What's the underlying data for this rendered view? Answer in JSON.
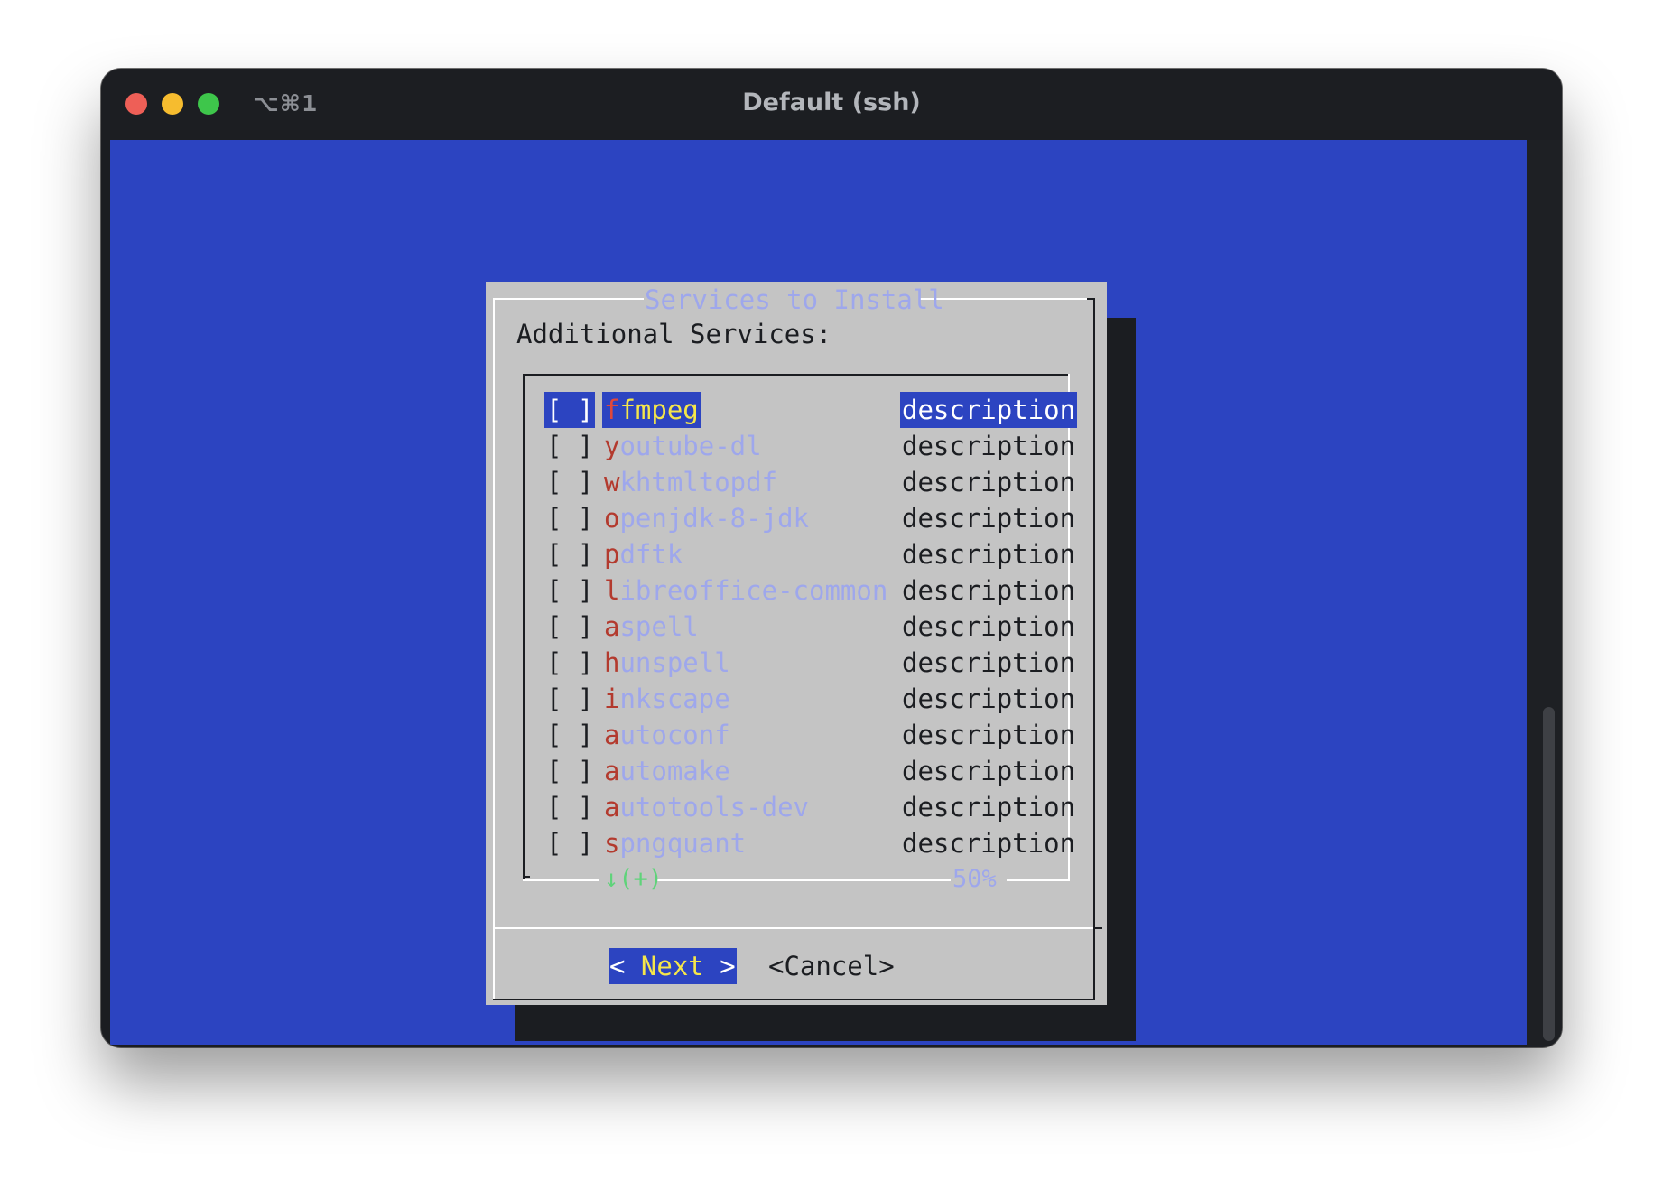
{
  "window": {
    "tab_shortcut": "⌥⌘1",
    "title": "Default (ssh)"
  },
  "dialog": {
    "title": "Services to Install",
    "subtitle": "Additional Services:",
    "items": [
      {
        "checkbox": "[ ]",
        "hotkey": "f",
        "rest": "fmpeg",
        "description": "description",
        "selected": true
      },
      {
        "checkbox": "[ ]",
        "hotkey": "y",
        "rest": "outube-dl",
        "description": "description",
        "selected": false
      },
      {
        "checkbox": "[ ]",
        "hotkey": "w",
        "rest": "khtmltopdf",
        "description": "description",
        "selected": false
      },
      {
        "checkbox": "[ ]",
        "hotkey": "o",
        "rest": "penjdk-8-jdk",
        "description": "description",
        "selected": false
      },
      {
        "checkbox": "[ ]",
        "hotkey": "p",
        "rest": "dftk",
        "description": "description",
        "selected": false
      },
      {
        "checkbox": "[ ]",
        "hotkey": "l",
        "rest": "ibreoffice-common",
        "description": "description",
        "selected": false
      },
      {
        "checkbox": "[ ]",
        "hotkey": "a",
        "rest": "spell",
        "description": "description",
        "selected": false
      },
      {
        "checkbox": "[ ]",
        "hotkey": "h",
        "rest": "unspell",
        "description": "description",
        "selected": false
      },
      {
        "checkbox": "[ ]",
        "hotkey": "i",
        "rest": "nkscape",
        "description": "description",
        "selected": false
      },
      {
        "checkbox": "[ ]",
        "hotkey": "a",
        "rest": "utoconf",
        "description": "description",
        "selected": false
      },
      {
        "checkbox": "[ ]",
        "hotkey": "a",
        "rest": "utomake",
        "description": "description",
        "selected": false
      },
      {
        "checkbox": "[ ]",
        "hotkey": "a",
        "rest": "utotools-dev",
        "description": "description",
        "selected": false
      },
      {
        "checkbox": "[ ]",
        "hotkey": "s",
        "rest": "pngquant",
        "description": "description",
        "selected": false
      }
    ],
    "scroll_indicator": "↓(+)",
    "scroll_percent": "50%",
    "buttons": {
      "next_left": "<",
      "next_label": " Next ",
      "next_right": ">",
      "cancel": "<Cancel>"
    }
  },
  "colors": {
    "terminal_bg": "#2c44c1",
    "dialog_bg": "#c4c4c4",
    "hotkey": "#b33a2e",
    "item_text": "#9ea7ec",
    "highlight_text": "#f5e64a",
    "scroll_indicator": "#5fd37a"
  }
}
